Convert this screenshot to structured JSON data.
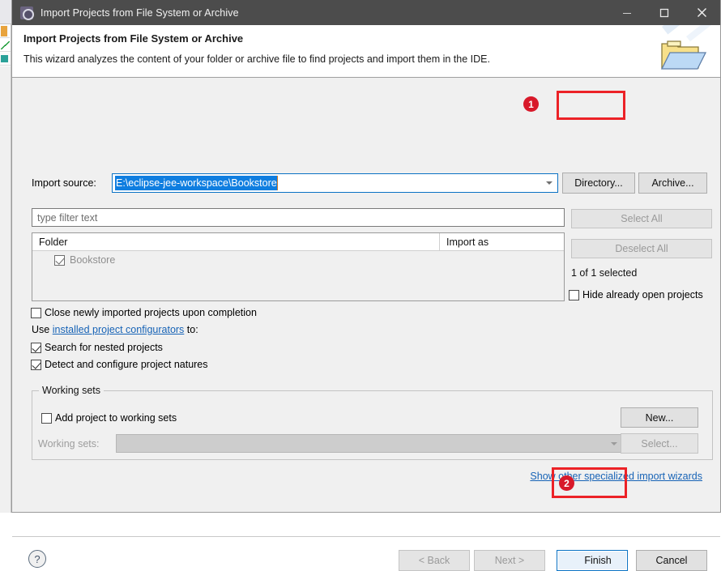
{
  "window": {
    "title": "Import Projects from File System or Archive",
    "icon": "gear-icon",
    "minimize_label": "—",
    "maximize_label": "□",
    "close_label": "✕"
  },
  "header": {
    "title": "Import Projects from File System or Archive",
    "description": "This wizard analyzes the content of your folder or archive file to find projects and import them in the IDE.",
    "icon": "folder-icon"
  },
  "form": {
    "import_source_label": "Import source:",
    "import_source_value": "E:\\eclipse-jee-workspace\\Bookstore",
    "directory_button": "Directory...",
    "archive_button": "Archive...",
    "filter_placeholder": "type filter text"
  },
  "table": {
    "columns": [
      "Folder",
      "Import as"
    ],
    "rows": [
      {
        "folder": "Bookstore",
        "checked": true,
        "import_as": ""
      }
    ]
  },
  "side_buttons": {
    "select_all": "Select All",
    "deselect_all": "Deselect All",
    "selection_count": "1 of 1 selected",
    "hide_open_projects": "Hide already open projects",
    "hide_open_projects_checked": false
  },
  "options": {
    "close_newly_imported": "Close newly imported projects upon completion",
    "close_newly_imported_checked": false,
    "use_prefix": "Use",
    "configurators_link": "installed project configurators",
    "use_suffix": "to:",
    "search_nested": "Search for nested projects",
    "search_nested_checked": true,
    "detect_natures": "Detect and configure project natures",
    "detect_natures_checked": true
  },
  "working_sets": {
    "group_title": "Working sets",
    "add_checkbox": "Add project to working sets",
    "add_checked": false,
    "new_button": "New...",
    "label": "Working sets:",
    "value": "",
    "select_button": "Select..."
  },
  "links": {
    "show_other_wizards": "Show other specialized import wizards"
  },
  "footer": {
    "help": "?",
    "back": "< Back",
    "next": "Next >",
    "finish": "Finish",
    "cancel": "Cancel"
  },
  "annotations": {
    "badge_one": "1",
    "badge_two": "2",
    "highlight_color": "#ec2227",
    "badge_color": "#d8192a"
  }
}
